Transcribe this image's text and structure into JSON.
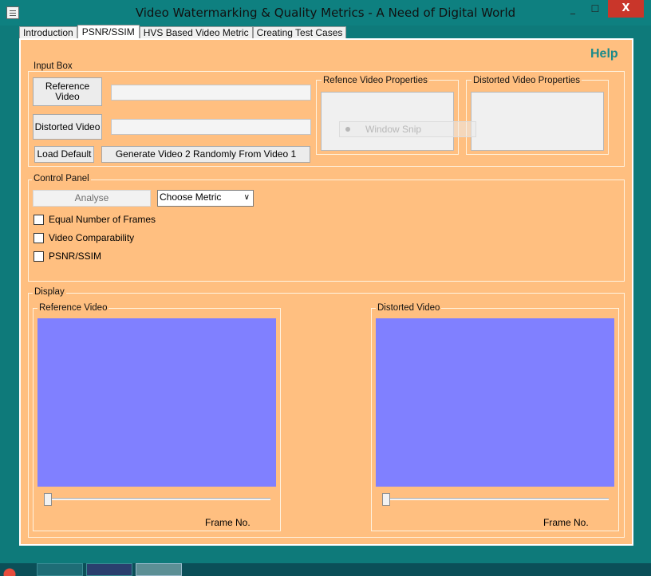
{
  "window": {
    "title": "Video Watermarking & Quality Metrics - A Need of Digital World",
    "minimize": "_",
    "maximize": "☐",
    "close": "X"
  },
  "tabs": [
    {
      "label": "Introduction"
    },
    {
      "label": "PSNR/SSIM",
      "active": true
    },
    {
      "label": "HVS Based Video Metric"
    },
    {
      "label": "Creating Test Cases"
    }
  ],
  "help_label": "Help",
  "input_box": {
    "label": "Input Box",
    "reference_button": "Reference Video",
    "distorted_button": "Distorted Video",
    "reference_path": "",
    "distorted_path": "",
    "load_default": "Load Default",
    "generate": "Generate Video 2 Randomly From Video 1",
    "ref_props_label": "Refence Video Properties",
    "dist_props_label": "Distorted Video Properties"
  },
  "control_panel": {
    "label": "Control Panel",
    "analyse": "Analyse",
    "metric_selected": "Choose Metric",
    "checkboxes": [
      {
        "label": "Equal Number of Frames",
        "checked": false
      },
      {
        "label": "Video Comparability",
        "checked": false
      },
      {
        "label": "PSNR/SSIM",
        "checked": false
      }
    ]
  },
  "display": {
    "label": "Display",
    "reference_label": "Reference Video",
    "distorted_label": "Distorted Video",
    "frame_label": "Frame No.",
    "reference_frame_position": 0,
    "distorted_frame_position": 0
  },
  "overlay": {
    "window_snip": "Window Snip"
  },
  "colors": {
    "panel": "#ffbf80",
    "video": "#8080ff",
    "frame": "#0e8080",
    "help": "#1a8a8a"
  }
}
